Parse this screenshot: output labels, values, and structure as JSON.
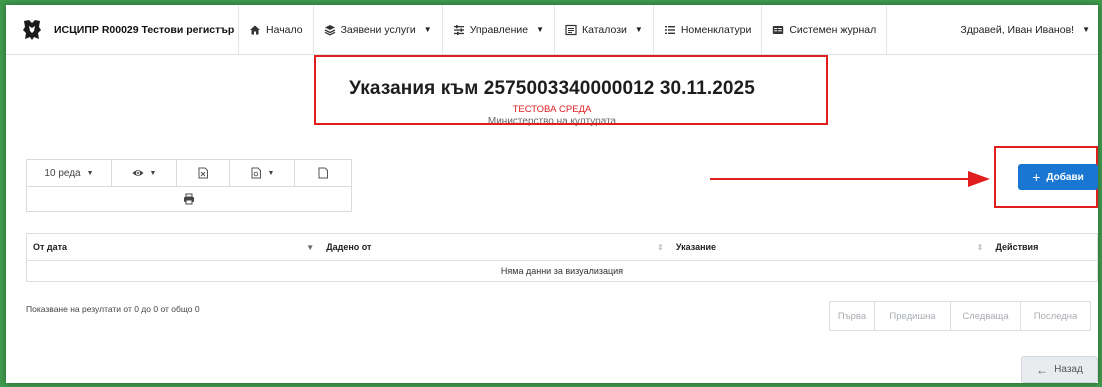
{
  "navbar": {
    "brand": "ИСЦИПР R00029 Тестови регистър",
    "items": [
      {
        "label": "Начало",
        "icon": "home-icon",
        "dropdown": false
      },
      {
        "label": "Заявени услуги",
        "icon": "layers-icon",
        "dropdown": true
      },
      {
        "label": "Управление",
        "icon": "sliders-icon",
        "dropdown": true
      },
      {
        "label": "Каталози",
        "icon": "catalog-icon",
        "dropdown": true
      },
      {
        "label": "Номенклатури",
        "icon": "list-icon",
        "dropdown": false
      },
      {
        "label": "Системен журнал",
        "icon": "journal-icon",
        "dropdown": false
      }
    ],
    "user": "Здравей, Иван Иванов!"
  },
  "page": {
    "title": "Указания към 2575003340000012 30.11.2025",
    "env": "ТЕСТОВА СРЕДА",
    "ministry": "Министерство на културата"
  },
  "toolbar": {
    "page_length": "10 реда",
    "icons": [
      "eye-icon",
      "excel-icon",
      "pdf-icon",
      "file-icon",
      "print-icon"
    ]
  },
  "add_button": {
    "label": "Добави",
    "icon": "plus-icon"
  },
  "table": {
    "columns": [
      "От дата",
      "Дадено от",
      "Указание",
      "Действия"
    ],
    "empty": "Няма данни за визуализация"
  },
  "info": "Показване на резултати от 0 до 0 от общо 0",
  "pagination": [
    "Първа",
    "Предишна",
    "Следваща",
    "Последна"
  ],
  "back_button": {
    "label": "Назад",
    "icon": "arrow-left-icon"
  },
  "colors": {
    "primary": "#1976d2",
    "highlight": "#e01e1e",
    "env": "#e02020",
    "border_bg": "#3f9a4c"
  }
}
